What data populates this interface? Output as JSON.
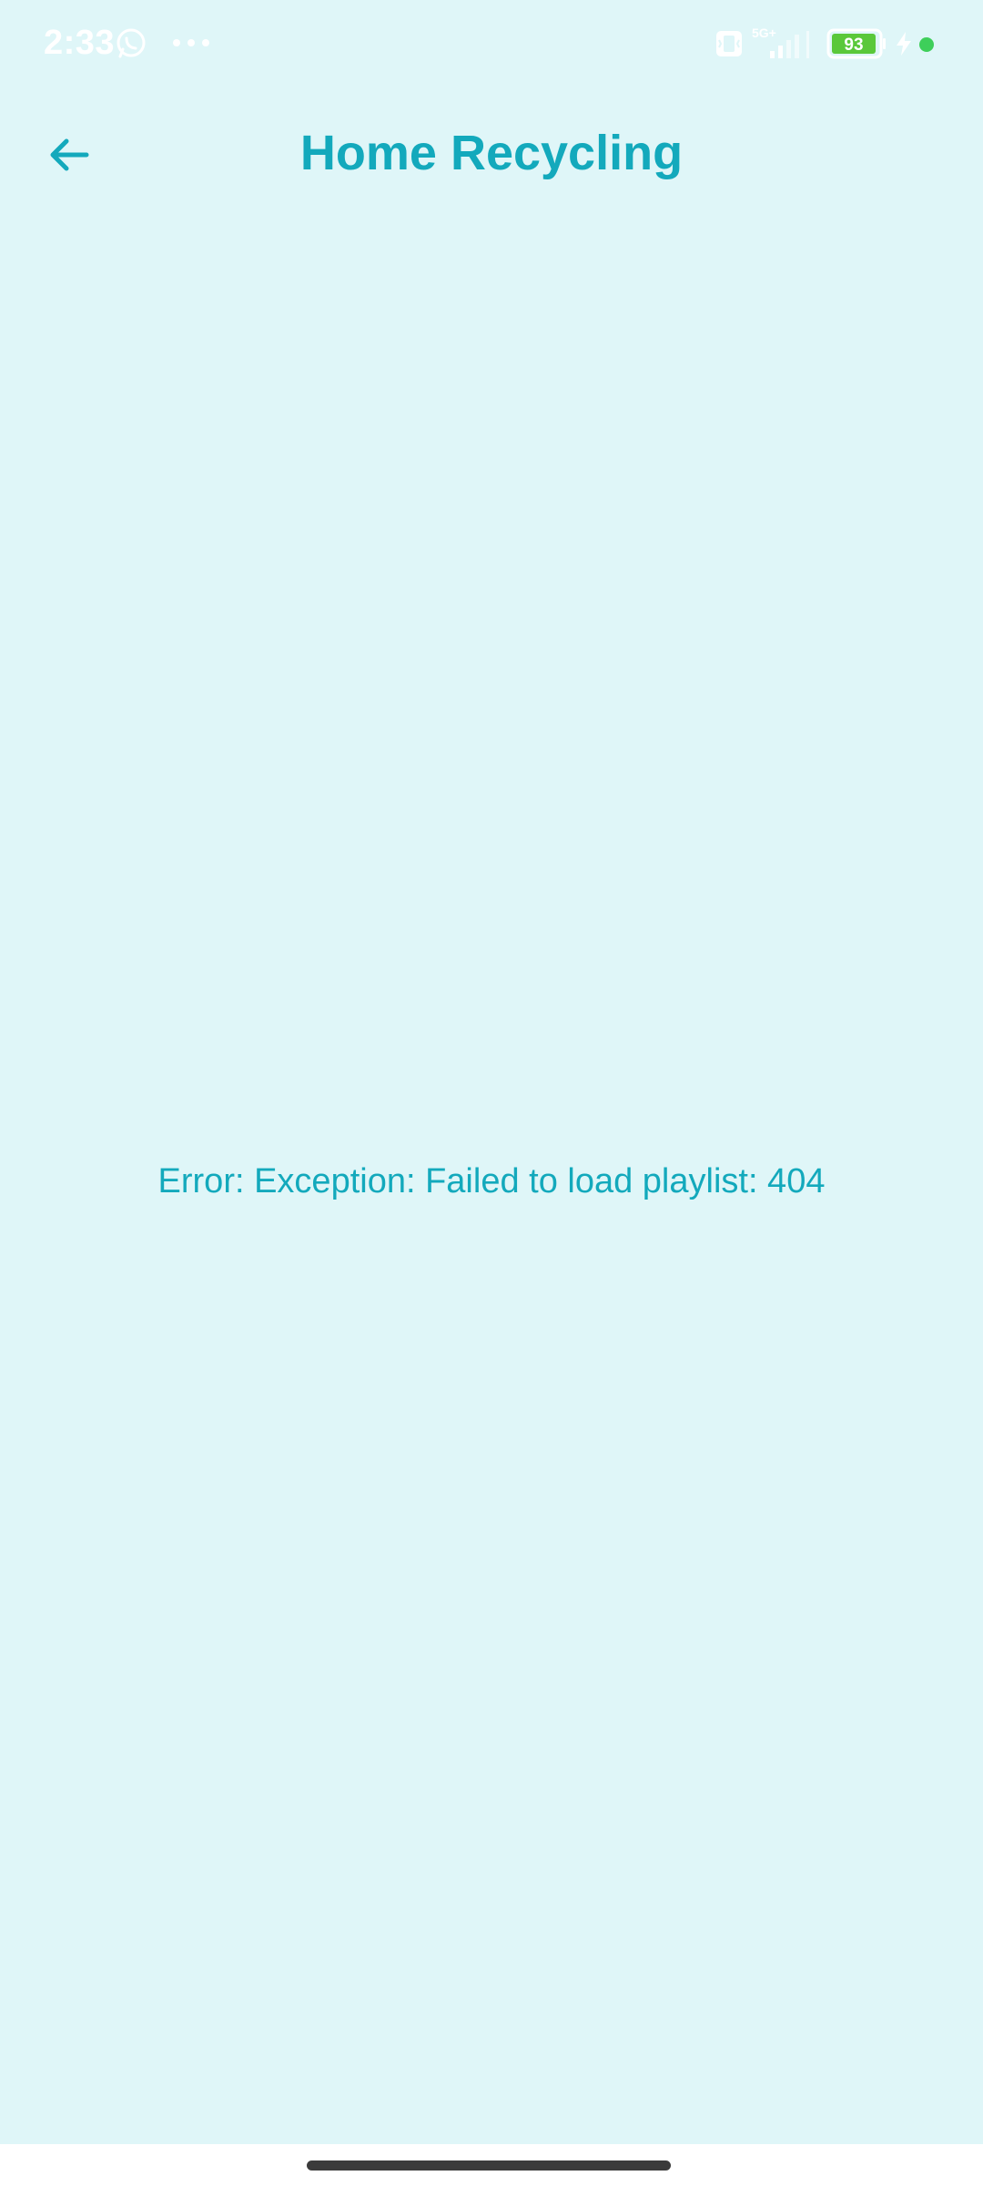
{
  "status_bar": {
    "time": "2:33",
    "network": "5G+",
    "battery_level": "93",
    "icons": [
      "whatsapp-icon",
      "more-dots-icon",
      "vibrate-icon",
      "signal-icon",
      "battery-icon",
      "charging-icon"
    ]
  },
  "app_bar": {
    "title": "Home Recycling",
    "back_icon": "arrow-back-icon"
  },
  "main": {
    "error_message": "Error: Exception: Failed to load playlist: 404"
  },
  "colors": {
    "background": "#dff6f8",
    "accent": "#13a9bc",
    "battery_fill": "#5ac83a",
    "status_dot": "#3ecf5a"
  }
}
